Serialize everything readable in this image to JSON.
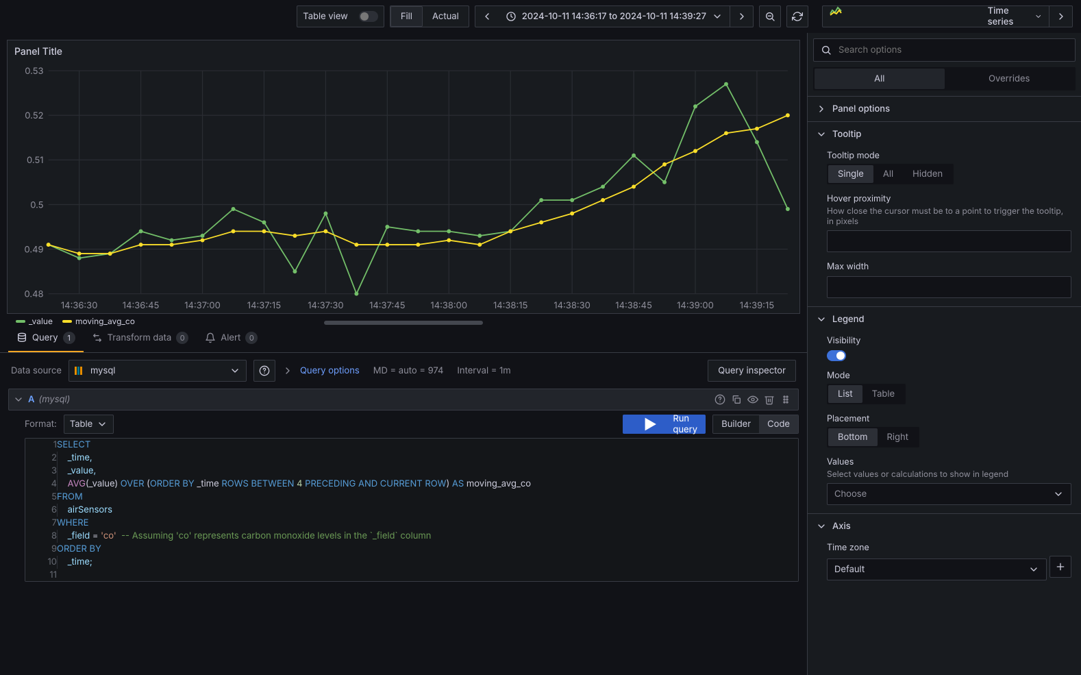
{
  "top": {
    "tableView": "Table view",
    "fill": "Fill",
    "actual": "Actual",
    "timeRange": "2024-10-11 14:36:17 to 2024-10-11 14:39:27",
    "vizType": "Time series"
  },
  "panel": {
    "title": "Panel Title",
    "legend": {
      "s1": "_value",
      "s2": "moving_avg_co"
    }
  },
  "chart_data": {
    "type": "line",
    "xlabel": "",
    "ylabel": "",
    "ylim": [
      0.48,
      0.53
    ],
    "x_ticks": [
      "14:36:30",
      "14:36:45",
      "14:37:00",
      "14:37:15",
      "14:37:30",
      "14:37:45",
      "14:38:00",
      "14:38:15",
      "14:38:30",
      "14:38:45",
      "14:39:00",
      "14:39:15"
    ],
    "y_ticks": [
      0.48,
      0.49,
      0.5,
      0.51,
      0.52,
      0.53
    ],
    "x_count": 25,
    "series": [
      {
        "name": "_value",
        "color": "#73bf69",
        "values": [
          0.491,
          0.488,
          0.489,
          0.494,
          0.492,
          0.493,
          0.499,
          0.496,
          0.485,
          0.498,
          0.48,
          0.495,
          0.494,
          0.494,
          0.493,
          0.494,
          0.501,
          0.501,
          0.504,
          0.511,
          0.505,
          0.522,
          0.527,
          0.514,
          0.499
        ]
      },
      {
        "name": "moving_avg_co",
        "color": "#fade2a",
        "values": [
          0.491,
          0.489,
          0.489,
          0.491,
          0.491,
          0.492,
          0.494,
          0.494,
          0.493,
          0.494,
          0.491,
          0.491,
          0.491,
          0.492,
          0.491,
          0.494,
          0.496,
          0.498,
          0.501,
          0.504,
          0.509,
          0.512,
          0.516,
          0.517,
          0.52
        ]
      }
    ]
  },
  "tabs": {
    "query": "Query",
    "queryCount": "1",
    "transform": "Transform data",
    "transformCount": "0",
    "alert": "Alert",
    "alertCount": "0"
  },
  "dsRow": {
    "label": "Data source",
    "ds": "mysql",
    "qOptions": "Query options",
    "md": "MD = auto = 974",
    "interval": "Interval = 1m",
    "inspector": "Query inspector"
  },
  "q": {
    "name": "A",
    "badge": "(mysql)",
    "formatLabel": "Format:",
    "formatVal": "Table",
    "run": "Run query",
    "builder": "Builder",
    "code": "Code"
  },
  "sql": {
    "l1": "SELECT",
    "l2_a": "_time,",
    "l3_a": "_value,",
    "l4_fn": "AVG",
    "l4_a": "(_value) ",
    "l4_k1": "OVER",
    "l4_b": " (",
    "l4_k2": "ORDER",
    "l4_k3": " BY",
    "l4_c": " _time ",
    "l4_k4": "ROWS",
    "l4_k5": " BETWEEN",
    "l4_n": " 4 ",
    "l4_k6": "PRECEDING",
    "l4_k7": " AND",
    "l4_k8": " CURRENT",
    "l4_k9": " ROW",
    "l4_d": ") ",
    "l4_k10": "AS",
    "l4_e": " moving_avg_co",
    "l5": "FROM",
    "l6": "airSensors",
    "l7": "WHERE",
    "l8_a": "_field ",
    "l8_eq": "=",
    "l8_b": " ",
    "l8_s": "'co'",
    "l8_c": "  ",
    "l8_cm": "-- Assuming 'co' represents carbon monoxide levels in the `_field` column",
    "l9": "ORDER BY",
    "l10": "_time;"
  },
  "opts": {
    "searchPh": "Search options",
    "all": "All",
    "overrides": "Overrides",
    "panelOptions": "Panel options",
    "tooltip": "Tooltip",
    "tooltipMode": "Tooltip mode",
    "single": "Single",
    "tAll": "All",
    "hidden": "Hidden",
    "hover": "Hover proximity",
    "hoverDesc": "How close the cursor must be to a point to trigger the tooltip, in pixels",
    "maxW": "Max width",
    "legend": "Legend",
    "visibility": "Visibility",
    "mode": "Mode",
    "list": "List",
    "table": "Table",
    "placement": "Placement",
    "bottom": "Bottom",
    "right": "Right",
    "values": "Values",
    "valuesDesc": "Select values or calculations to show in legend",
    "choose": "Choose",
    "axis": "Axis",
    "tz": "Time zone",
    "tzVal": "Default"
  }
}
